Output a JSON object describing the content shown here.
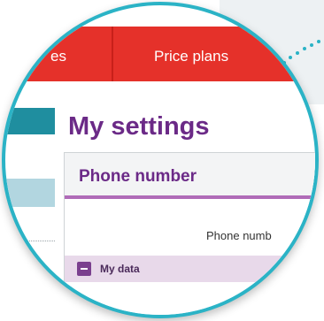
{
  "nav": {
    "prev_item_label": "es",
    "price_plans_label": "Price plans"
  },
  "page": {
    "title": "My settings"
  },
  "section": {
    "title": "Phone number",
    "phone_field_label": "Phone numb",
    "my_data_label": "My data"
  },
  "colors": {
    "nav_red": "#e5312a",
    "lens_border": "#2bb3c6",
    "title_purple": "#6b2a87",
    "accent_purple": "#b06bb8",
    "sidebar_teal": "#1f8e9f",
    "sidebar_light": "#b2d6e0"
  },
  "icons": {
    "collapse": "minus-square-icon"
  }
}
